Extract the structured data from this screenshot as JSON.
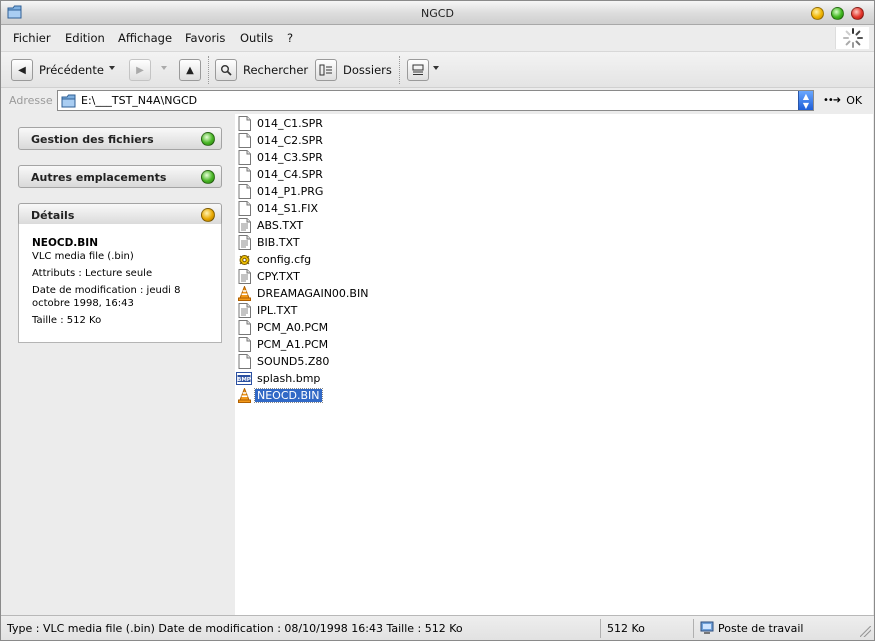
{
  "window": {
    "title": "NGCD"
  },
  "menubar": {
    "items": [
      "Fichier",
      "Edition",
      "Affichage",
      "Favoris",
      "Outils",
      "?"
    ]
  },
  "toolbar": {
    "back_label": "Précédente",
    "search_label": "Rechercher",
    "folders_label": "Dossiers"
  },
  "address": {
    "label": "Adresse",
    "value": "E:\\___TST_N4A\\NGCD",
    "go_label": "OK"
  },
  "taskpane": {
    "file_tasks": "Gestion des fichiers",
    "other_places": "Autres emplacements",
    "details": {
      "title": "Détails",
      "name": "NEOCD.BIN",
      "type": "VLC media file (.bin)",
      "attributes": "Attributs : Lecture seule",
      "modified_line1": "Date de modification : jeudi 8",
      "modified_line2": "octobre 1998, 16:43",
      "size": "Taille : 512 Ko"
    }
  },
  "files": [
    {
      "name": "014_C1.SPR",
      "icon": "blank-file-icon"
    },
    {
      "name": "014_C2.SPR",
      "icon": "blank-file-icon"
    },
    {
      "name": "014_C3.SPR",
      "icon": "blank-file-icon"
    },
    {
      "name": "014_C4.SPR",
      "icon": "blank-file-icon"
    },
    {
      "name": "014_P1.PRG",
      "icon": "blank-file-icon"
    },
    {
      "name": "014_S1.FIX",
      "icon": "blank-file-icon"
    },
    {
      "name": "ABS.TXT",
      "icon": "text-file-icon"
    },
    {
      "name": "BIB.TXT",
      "icon": "text-file-icon"
    },
    {
      "name": "config.cfg",
      "icon": "config-file-icon"
    },
    {
      "name": "CPY.TXT",
      "icon": "text-file-icon"
    },
    {
      "name": "DREAMAGAIN00.BIN",
      "icon": "vlc-cone-icon"
    },
    {
      "name": "IPL.TXT",
      "icon": "text-file-icon"
    },
    {
      "name": "PCM_A0.PCM",
      "icon": "blank-file-icon"
    },
    {
      "name": "PCM_A1.PCM",
      "icon": "blank-file-icon"
    },
    {
      "name": "SOUND5.Z80",
      "icon": "blank-file-icon"
    },
    {
      "name": "splash.bmp",
      "icon": "bmp-file-icon"
    },
    {
      "name": "NEOCD.BIN",
      "icon": "vlc-cone-icon",
      "selected": true
    }
  ],
  "statusbar": {
    "info": "Type : VLC media file (.bin) Date de modification : 08/10/1998 16:43 Taille  : 512 Ko",
    "size": "512 Ko",
    "zone": "Poste de travail"
  },
  "colors": {
    "selection": "#3169c6",
    "orb_green": "#47b524",
    "orb_yellow": "#e8a800"
  }
}
